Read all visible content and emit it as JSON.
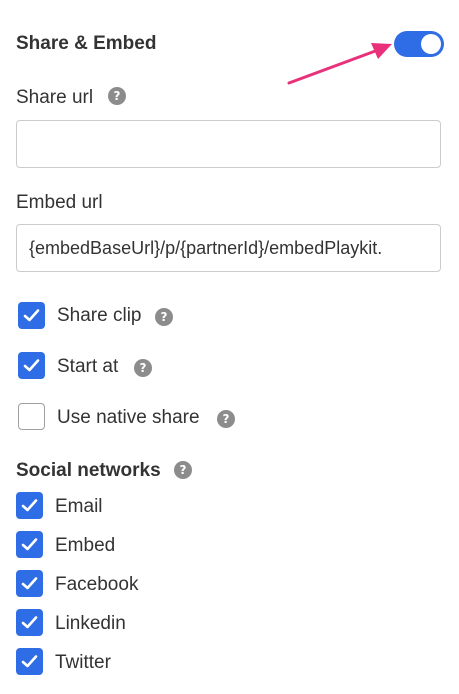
{
  "share_embed": {
    "title": "Share & Embed",
    "toggle_on": true
  },
  "share_url": {
    "label": "Share url",
    "value": "",
    "help_icon": "help-icon"
  },
  "embed_url": {
    "label": "Embed url",
    "value": "{embedBaseUrl}/p/{partnerId}/embedPlaykit."
  },
  "options": [
    {
      "label": "Share clip",
      "checked": true,
      "help_icon": "help-icon"
    },
    {
      "label": "Start at",
      "checked": true,
      "help_icon": "help-icon"
    },
    {
      "label": "Use native share",
      "checked": false,
      "help_icon": "help-icon"
    }
  ],
  "social_networks": {
    "title": "Social networks",
    "help_icon": "help-icon",
    "items": [
      {
        "label": "Email",
        "checked": true
      },
      {
        "label": "Embed",
        "checked": true
      },
      {
        "label": "Facebook",
        "checked": true
      },
      {
        "label": "Linkedin",
        "checked": true
      },
      {
        "label": "Twitter",
        "checked": true
      }
    ]
  },
  "colors": {
    "accent": "#2f6de6",
    "annotation_arrow": "#e8317a",
    "help_icon": "#8c8c8c"
  }
}
